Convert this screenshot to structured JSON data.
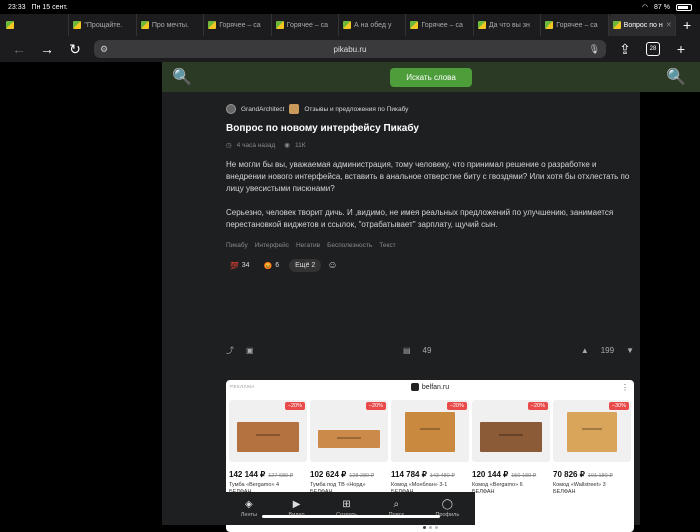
{
  "status": {
    "time": "23:33",
    "date": "Пн 15 сент.",
    "battery": "87 %",
    "battery_level": 0.87
  },
  "tabs": [
    {
      "label": ""
    },
    {
      "label": "\"Прощайте."
    },
    {
      "label": "Про мечты."
    },
    {
      "label": "Горячее – са"
    },
    {
      "label": "Горячее – са"
    },
    {
      "label": "А на обед у"
    },
    {
      "label": "Горячее – са"
    },
    {
      "label": "Да что вы зн"
    },
    {
      "label": "Горячее – са"
    },
    {
      "label": "Вопрос по н"
    }
  ],
  "toolbar": {
    "url": "pikabu.ru",
    "tab_count": "28"
  },
  "search": {
    "button_label": "Искать слова"
  },
  "post": {
    "author": "GrandArchitect",
    "community": "Отзывы и предложения по Пикабу",
    "title": "Вопрос по новому интерфейсу Пикабу",
    "time_ago": "4 часа назад",
    "views": "11К",
    "paragraph_1": "Не могли бы вы, уважаемая администрация, тому человеку, что принимал решение о разработке и внедрении нового интерфейса, вставить в анальное отверстие биту с гвоздями? Или хотя бы отхлестать по лицу увесистыми писюнами?",
    "paragraph_2": "Серьезно, человек творит дичь. И ,видимо, не имея реальных предложений по улучшению, занимается перестановкой виджетов и ссылок, \"отрабатывает\" зарплату, щучий сын.",
    "tags": [
      "Пикабу",
      "Интерфейс",
      "Негатив",
      "Бесполезность",
      "Текст"
    ],
    "reactions": [
      {
        "emoji": "💯",
        "count": "34"
      },
      {
        "emoji": "😡",
        "count": "6"
      }
    ],
    "more_reactions": "Ещё 2",
    "comments": "49",
    "rating": "199"
  },
  "ad": {
    "label": "РЕКЛАМА",
    "domain": "belfan.ru",
    "products": [
      {
        "discount": "−20%",
        "price": "142 144 ₽",
        "old_price": "127 680 ₽",
        "name": "Тумба «Bergamo» 4",
        "brand": "БЕЛФАН"
      },
      {
        "discount": "−20%",
        "price": "102 624 ₽",
        "old_price": "128 280 ₽",
        "name": "Тумба под ТВ «Норд»",
        "brand": "БЕЛФАН"
      },
      {
        "discount": "−20%",
        "price": "114 784 ₽",
        "old_price": "143 480 ₽",
        "name": "Комод «Монблан» 3-1",
        "brand": "БЕЛФАН"
      },
      {
        "discount": "−20%",
        "price": "120 144 ₽",
        "old_price": "150 180 ₽",
        "name": "Комод «Bergamo» 6",
        "brand": "БЕЛФАН"
      },
      {
        "discount": "−30%",
        "price": "70 826 ₽",
        "old_price": "101 180 ₽",
        "name": "Комод «Wallstreet» 3",
        "brand": "БЕЛФАН"
      }
    ]
  },
  "bottom_nav": [
    {
      "label": "Ленты",
      "icon": "feed-icon"
    },
    {
      "label": "Видео",
      "icon": "video-icon"
    },
    {
      "label": "Создать",
      "icon": "create-icon"
    },
    {
      "label": "Поиск",
      "icon": "search-icon"
    },
    {
      "label": "Профиль",
      "icon": "profile-icon"
    }
  ]
}
